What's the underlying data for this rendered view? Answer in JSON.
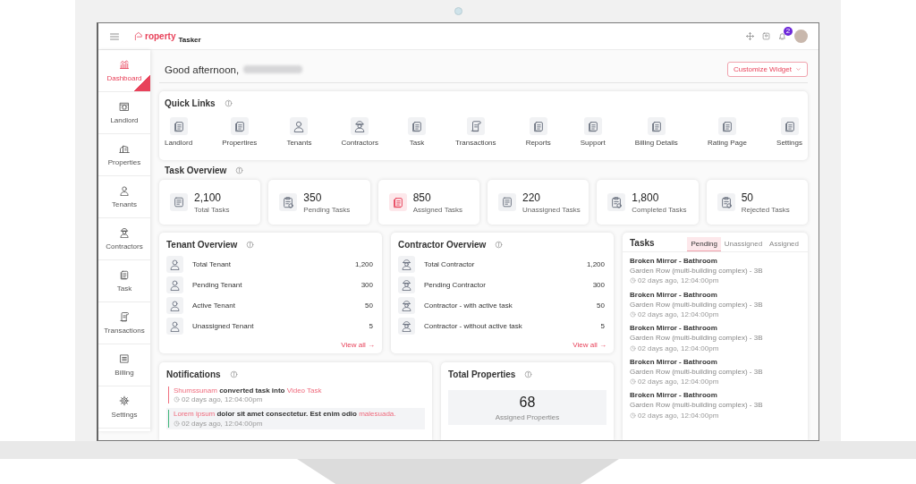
{
  "header": {
    "logo_text": "roperty",
    "logo_subtext": "Tasker",
    "notification_badge": "2"
  },
  "sidebar": {
    "items": [
      {
        "label": "Dashboard",
        "selected": true
      },
      {
        "label": "Landlord",
        "selected": false
      },
      {
        "label": "Properties",
        "selected": false
      },
      {
        "label": "Tenants",
        "selected": false
      },
      {
        "label": "Contractors",
        "selected": false
      },
      {
        "label": "Task",
        "selected": false
      },
      {
        "label": "Transactions",
        "selected": false
      },
      {
        "label": "Billing",
        "selected": false
      },
      {
        "label": "Settings",
        "selected": false
      }
    ]
  },
  "greeting": "Good afternoon,",
  "customize_button": "Customize Widget",
  "quick_links": {
    "title": "Quick Links",
    "items": [
      "Landlord",
      "Propertires",
      "Tenants",
      "Contractors",
      "Task",
      "Transactions",
      "Reports",
      "Support",
      "Billing Details",
      "Rating Page",
      "Settings"
    ]
  },
  "task_overview": {
    "title": "Task Overview",
    "cards": [
      {
        "value": "2,100",
        "label": "Total Tasks",
        "highlighted": false
      },
      {
        "value": "350",
        "label": "Pending Tasks",
        "highlighted": false
      },
      {
        "value": "850",
        "label": "Assigned Tasks",
        "highlighted": true
      },
      {
        "value": "220",
        "label": "Unassigned Tasks",
        "highlighted": false
      },
      {
        "value": "1,800",
        "label": "Completed Tasks",
        "highlighted": false
      },
      {
        "value": "50",
        "label": "Rejected Tasks",
        "highlighted": false
      }
    ]
  },
  "tenant_overview": {
    "title": "Tenant Overview",
    "rows": [
      {
        "label": "Total Tenant",
        "value": "1,200"
      },
      {
        "label": "Pending Tenant",
        "value": "300"
      },
      {
        "label": "Active Tenant",
        "value": "50"
      },
      {
        "label": "Unassigned Tenant",
        "value": "5"
      }
    ],
    "link": "View all →"
  },
  "contractor_overview": {
    "title": "Contractor Overview",
    "rows": [
      {
        "label": "Total Contractor",
        "value": "1,200"
      },
      {
        "label": "Pending Contractor",
        "value": "300"
      },
      {
        "label": "Contractor - with active task",
        "value": "50"
      },
      {
        "label": "Contractor - without active task",
        "value": "5"
      }
    ],
    "link": "View all →"
  },
  "tasks": {
    "title": "Tasks",
    "tabs": [
      {
        "label": "Pending",
        "selected": true
      },
      {
        "label": "Unassigned",
        "selected": false
      },
      {
        "label": "Assigned",
        "selected": false
      }
    ],
    "items": [
      {
        "title": "Broken Mirror - Bathroom",
        "subtitle": "Garden Row (multi-building complex) - 3B",
        "time": "02 days ago, 12:04:00pm"
      },
      {
        "title": "Broken Mirror - Bathroom",
        "subtitle": "Garden Row (multi-building complex) - 3B",
        "time": "02 days ago, 12:04:00pm"
      },
      {
        "title": "Broken Mirror - Bathroom",
        "subtitle": "Garden Row (multi-building complex) - 3B",
        "time": "02 days ago, 12:04:00pm"
      },
      {
        "title": "Broken Mirror - Bathroom",
        "subtitle": "Garden Row (multi-building complex) - 3B",
        "time": "02 days ago, 12:04:00pm"
      },
      {
        "title": "Broken Mirror - Bathroom",
        "subtitle": "Garden Row (multi-building complex) - 3B",
        "time": "02 days ago, 12:04:00pm"
      }
    ]
  },
  "notifications": {
    "title": "Notifications",
    "items": [
      {
        "color": "#f0707f",
        "highlighted": false,
        "parts": [
          {
            "text": "Shumssunam",
            "kind": "link"
          },
          {
            "text": " converted task into ",
            "kind": "plain"
          },
          {
            "text": "Video Task",
            "kind": "link"
          }
        ],
        "time": "02 days ago, 12:04:00pm"
      },
      {
        "color": "#3fb67a",
        "highlighted": true,
        "parts": [
          {
            "text": "Lorem ipsum",
            "kind": "link"
          },
          {
            "text": " dolor sit amet consectetur. Est enim odio ",
            "kind": "plain"
          },
          {
            "text": "malesuada.",
            "kind": "link"
          }
        ],
        "time": "02 days ago, 12:04:00pm"
      }
    ]
  },
  "total_properties": {
    "title": "Total Properties",
    "value": "68",
    "label": "Assigned Properties"
  }
}
